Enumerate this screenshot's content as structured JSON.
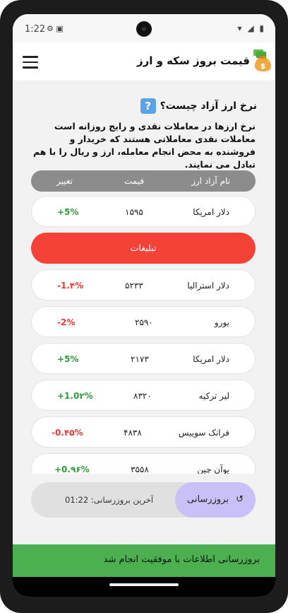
{
  "status": {
    "time": "1:22",
    "icons": "⚙ ▣",
    "right_icons": "▾ ◢ ▮"
  },
  "appbar": {
    "title": "قیمت بروز سکه و ارز",
    "menu_icon": "menu-icon",
    "logo_icon": "money-bag-icon"
  },
  "info": {
    "question": "نرخ ارز آزاد چیست؟",
    "description": "نرخ ارزها در معاملات نقدی و رایج روزانه است معاملات نقدی معاملاتی هستند که خریدار و فروشنده به محض انجام معامله، ارز و ریال را با هم تبادل می نمایند."
  },
  "table": {
    "headers": {
      "name": "نام آزاد ارز",
      "price": "قیمت",
      "change": "تغییر"
    },
    "rows": [
      {
        "name": "دلار امریکا",
        "price": "۱۵۹۵",
        "change": "+5%",
        "sign": "pos"
      },
      {
        "name": "دلار استرالیا",
        "price": "۵۲۳۳",
        "change": "-1.۴%",
        "sign": "neg"
      },
      {
        "name": "یورو",
        "price": "۲۵۹۰",
        "change": "-2%",
        "sign": "neg"
      },
      {
        "name": "دلار امریکا",
        "price": "۲۱۷۳",
        "change": "+5%",
        "sign": "pos"
      },
      {
        "name": "لیر ترکیه",
        "price": "۸۳۲۰",
        "change": "+1.0۲%",
        "sign": "pos"
      },
      {
        "name": "فرانک سوییس",
        "price": "۴۸۳۸",
        "change": "-0.۴۵%",
        "sign": "neg"
      },
      {
        "name": "یوآن چین",
        "price": "۳۵۵۸",
        "change": "+0.۹۶%",
        "sign": "pos"
      }
    ]
  },
  "ad": {
    "label": "تبلیغات"
  },
  "update": {
    "last_label": "آخرین بروزرسانی: 01:22",
    "refresh_label": "بروزرسانی",
    "refresh_icon": "refresh-icon"
  },
  "snackbar": {
    "message": "بروزرسانی اطلاعات با موفقیت انجام شد"
  },
  "colors": {
    "positive": "#2e9b3a",
    "negative": "#e53935",
    "ad": "#f44336",
    "snackbar": "#4caf50",
    "refresh": "#c9c1f5"
  }
}
